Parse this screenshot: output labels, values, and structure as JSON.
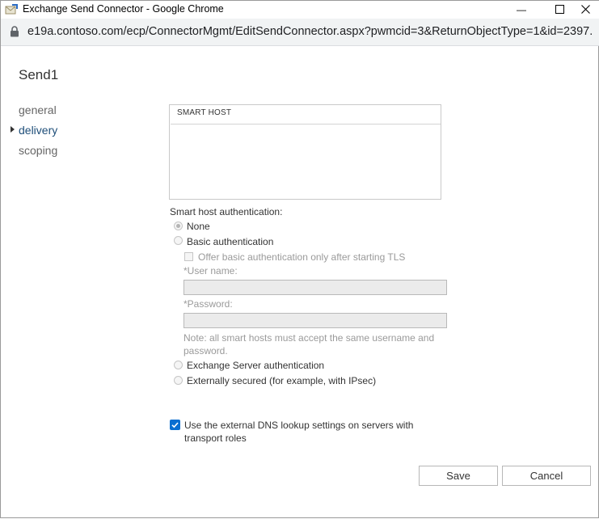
{
  "window": {
    "title": "Exchange Send Connector - Google Chrome",
    "minimize_glyph": "—",
    "maximize_glyph": "☐",
    "close_glyph": "✕"
  },
  "browser": {
    "url": "e19a.contoso.com/ecp/ConnectorMgmt/EditSendConnector.aspx?pwmcid=3&ReturnObjectType=1&id=2397..."
  },
  "page": {
    "title": "Send1",
    "nav": [
      {
        "label": "general",
        "active": false
      },
      {
        "label": "delivery",
        "active": true
      },
      {
        "label": "scoping",
        "active": false
      }
    ],
    "smart_host_list": {
      "column_header": "SMART HOST"
    },
    "auth": {
      "heading": "Smart host authentication:",
      "none_label": "None",
      "basic_label": "Basic authentication",
      "offer_basic_label": "Offer basic authentication only after starting TLS",
      "username_label": "*User name:",
      "username_value": "",
      "password_label": "*Password:",
      "password_value": "",
      "note": "Note: all smart hosts must accept the same username and password.",
      "exchange_label": "Exchange Server authentication",
      "external_label": "Externally secured (for example, with IPsec)"
    },
    "dns": {
      "label": "Use the external DNS lookup settings on servers with transport roles",
      "checked": true
    },
    "buttons": {
      "save": "Save",
      "cancel": "Cancel"
    }
  },
  "colors": {
    "accent": "#0a6ed1",
    "nav_active": "#1e4e79"
  }
}
